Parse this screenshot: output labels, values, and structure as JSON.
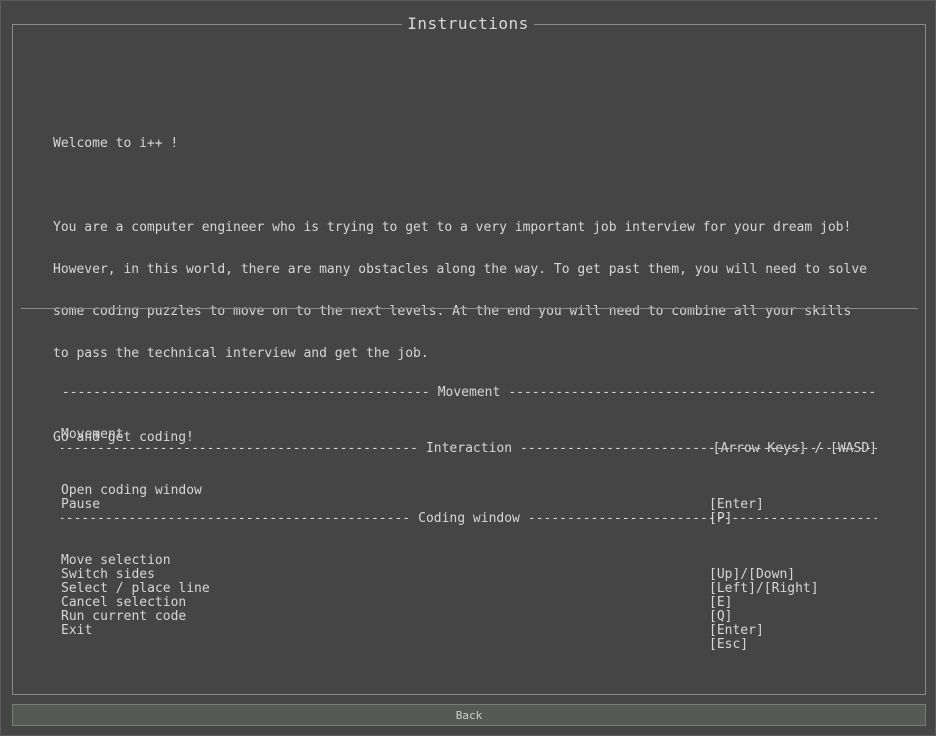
{
  "window": {
    "title": "Instructions"
  },
  "intro": {
    "welcome": "Welcome to i++ !",
    "paragraph_lines": [
      "You are a computer engineer who is trying to get to a very important job interview for your dream job!",
      "However, in this world, there are many obstacles along the way. To get past them, you will need to solve",
      "some coding puzzles to move on to the next levels. At the end you will need to combine all your skills",
      "to pass the technical interview and get the job."
    ],
    "closing": "Go and get coding!"
  },
  "controls": {
    "movement": {
      "title": "Movement",
      "rows": [
        {
          "action": "Movement",
          "keys": "[Arrow Keys] / [WASD]"
        }
      ]
    },
    "interaction": {
      "title": "Interaction",
      "rows": [
        {
          "action": "Open coding window",
          "keys": "[Enter]"
        },
        {
          "action": "Pause",
          "keys": "[P]"
        }
      ]
    },
    "coding_window": {
      "title": "Coding window",
      "rows": [
        {
          "action": "Move selection",
          "keys": "[Up]/[Down]"
        },
        {
          "action": "Switch sides",
          "keys": "[Left]/[Right]"
        },
        {
          "action": "Select / place line",
          "keys": "[E]"
        },
        {
          "action": "Cancel selection",
          "keys": "[Q]"
        },
        {
          "action": "Run current code",
          "keys": "[Enter]"
        },
        {
          "action": "Exit",
          "keys": "[Esc]"
        }
      ]
    }
  },
  "back_button": {
    "label": "Back"
  }
}
